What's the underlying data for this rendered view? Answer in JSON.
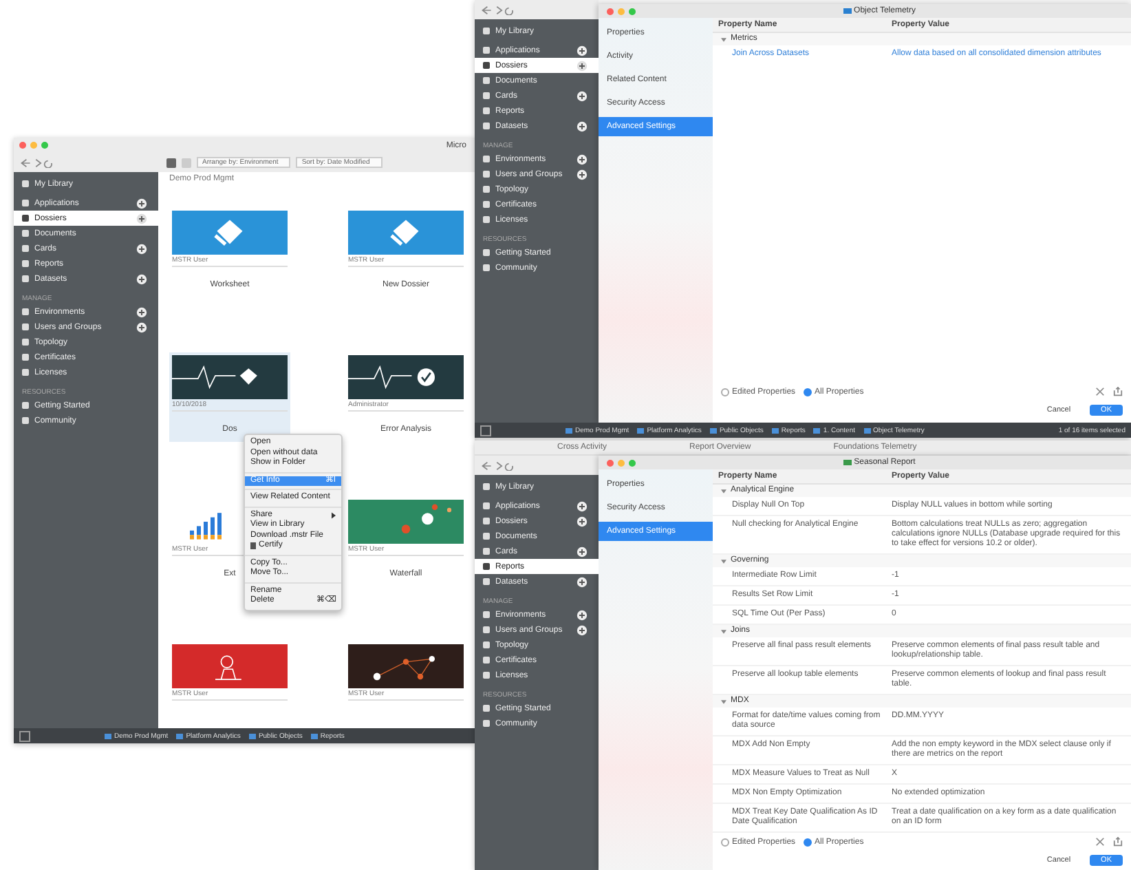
{
  "windows": [
    {
      "kind": "library",
      "title": "Micro",
      "toolbar": {
        "arrange": "Arrange by: Environment",
        "sort": "Sort by: Date Modified"
      },
      "sidebar": {
        "sections": [
          {
            "items": [
              {
                "label": "My Library",
                "selected": false,
                "add": false
              }
            ]
          },
          {
            "items": [
              {
                "label": "Applications",
                "selected": false,
                "add": true
              },
              {
                "label": "Dossiers",
                "selected": true,
                "add": true
              },
              {
                "label": "Documents",
                "selected": false,
                "add": false
              },
              {
                "label": "Cards",
                "selected": false,
                "add": true
              },
              {
                "label": "Reports",
                "selected": false,
                "add": false
              },
              {
                "label": "Datasets",
                "selected": false,
                "add": true
              }
            ]
          },
          {
            "header": "MANAGE",
            "items": [
              {
                "label": "Environments",
                "selected": false,
                "add": true
              },
              {
                "label": "Users and Groups",
                "selected": false,
                "add": true
              },
              {
                "label": "Topology",
                "selected": false,
                "add": false
              },
              {
                "label": "Certificates",
                "selected": false,
                "add": false
              },
              {
                "label": "Licenses",
                "selected": false,
                "add": false
              }
            ]
          },
          {
            "header": "RESOURCES",
            "items": [
              {
                "label": "Getting Started",
                "selected": false,
                "add": false
              },
              {
                "label": "Community",
                "selected": false,
                "add": false
              }
            ]
          }
        ]
      },
      "group": "Demo Prod Mgmt",
      "cards": [
        {
          "kind": "blue",
          "owner": "MSTR User",
          "title": "Worksheet",
          "selected": false
        },
        {
          "kind": "blue",
          "owner": "MSTR User",
          "title": "New Dossier",
          "selected": false
        },
        {
          "kind": "pulse",
          "owner": "10/10/2018",
          "title": "Dos",
          "selected": true
        },
        {
          "kind": "check",
          "owner": "Administrator",
          "title": "Error Analysis",
          "selected": false
        },
        {
          "kind": "bars",
          "owner": "MSTR User",
          "title": "Ext",
          "selected": false
        },
        {
          "kind": "bubbles",
          "owner": "MSTR User",
          "title": "Waterfall",
          "selected": false
        },
        {
          "kind": "red",
          "owner": "MSTR User",
          "selected": false
        },
        {
          "kind": "network",
          "owner": "MSTR User",
          "selected": false
        }
      ],
      "menu": [
        {
          "kind": "item",
          "label": "Open",
          "selected": false
        },
        {
          "kind": "item",
          "label": "Open without data",
          "selected": false
        },
        {
          "kind": "item",
          "label": "Show in Folder",
          "selected": false
        },
        {
          "kind": "separator"
        },
        {
          "kind": "item",
          "label": "Get Info",
          "shortcut": "⌘I",
          "selected": true
        },
        {
          "kind": "separator"
        },
        {
          "kind": "item",
          "label": "View Related Content",
          "selected": false
        },
        {
          "kind": "separator"
        },
        {
          "kind": "item",
          "label": "Share",
          "submenu": true,
          "selected": false
        },
        {
          "kind": "item",
          "label": "View in Library",
          "selected": false
        },
        {
          "kind": "item",
          "label": "Download .mstr File",
          "selected": false
        },
        {
          "kind": "item",
          "label": "Certify",
          "icon": true,
          "selected": false
        },
        {
          "kind": "separator"
        },
        {
          "kind": "item",
          "label": "Copy To...",
          "selected": false
        },
        {
          "kind": "item",
          "label": "Move To...",
          "selected": false
        },
        {
          "kind": "separator"
        },
        {
          "kind": "item",
          "label": "Rename",
          "selected": false
        },
        {
          "kind": "item",
          "label": "Delete",
          "shortcut": "⌘⌫",
          "selected": false
        }
      ],
      "breadcrumb": [
        "Demo Prod Mgmt",
        "Platform Analytics",
        "Public Objects",
        "Reports"
      ]
    },
    {
      "kind": "properties",
      "sidebar": {
        "sections": [
          {
            "items": [
              {
                "label": "My Library",
                "selected": false,
                "add": false
              }
            ]
          },
          {
            "items": [
              {
                "label": "Applications",
                "selected": false,
                "add": true
              },
              {
                "label": "Dossiers",
                "selected": true,
                "add": true
              },
              {
                "label": "Documents",
                "selected": false,
                "add": false
              },
              {
                "label": "Cards",
                "selected": false,
                "add": true
              },
              {
                "label": "Reports",
                "selected": false,
                "add": false
              },
              {
                "label": "Datasets",
                "selected": false,
                "add": true
              }
            ]
          },
          {
            "header": "MANAGE",
            "items": [
              {
                "label": "Environments",
                "selected": false,
                "add": true
              },
              {
                "label": "Users and Groups",
                "selected": false,
                "add": true
              },
              {
                "label": "Topology",
                "selected": false,
                "add": false
              },
              {
                "label": "Certificates",
                "selected": false,
                "add": false
              },
              {
                "label": "Licenses",
                "selected": false,
                "add": false
              }
            ]
          },
          {
            "header": "RESOURCES",
            "items": [
              {
                "label": "Getting Started",
                "selected": false,
                "add": false
              },
              {
                "label": "Community",
                "selected": false,
                "add": false
              }
            ]
          }
        ]
      },
      "dialog": {
        "title": "Object Telemetry",
        "nav": [
          {
            "label": "Properties",
            "selected": false
          },
          {
            "label": "Activity",
            "selected": false
          },
          {
            "label": "Related Content",
            "selected": false
          },
          {
            "label": "Security Access",
            "selected": false
          },
          {
            "label": "Advanced Settings",
            "selected": true
          }
        ],
        "columns": [
          "Property Name",
          "Property Value"
        ],
        "rows": [
          {
            "kind": "group",
            "label": "Metrics",
            "expanded": true
          },
          {
            "kind": "property",
            "name": "Join Across Datasets",
            "value": "Allow data based on all consolidated dimension attributes",
            "link": true
          }
        ],
        "filters": [
          {
            "label": "Edited Properties",
            "selected": false
          },
          {
            "label": "All Properties",
            "selected": true
          }
        ],
        "buttons": [
          "Cancel",
          "OK"
        ]
      },
      "breadcrumb": [
        "Demo Prod Mgmt",
        "Platform Analytics",
        "Public Objects",
        "Reports",
        "1. Content",
        "Object Telemetry"
      ],
      "status": "1 of 16 items selected"
    },
    {
      "kind": "properties",
      "tabs": [
        "Cross Activity",
        "Report Overview",
        "Foundations Telemetry"
      ],
      "sidebar": {
        "sections": [
          {
            "items": [
              {
                "label": "My Library",
                "selected": false,
                "add": false
              }
            ]
          },
          {
            "items": [
              {
                "label": "Applications",
                "selected": false,
                "add": true
              },
              {
                "label": "Dossiers",
                "selected": false,
                "add": true
              },
              {
                "label": "Documents",
                "selected": false,
                "add": false
              },
              {
                "label": "Cards",
                "selected": false,
                "add": true
              },
              {
                "label": "Reports",
                "selected": true,
                "add": false
              },
              {
                "label": "Datasets",
                "selected": false,
                "add": true
              }
            ]
          },
          {
            "header": "MANAGE",
            "items": [
              {
                "label": "Environments",
                "selected": false,
                "add": true
              },
              {
                "label": "Users and Groups",
                "selected": false,
                "add": true
              },
              {
                "label": "Topology",
                "selected": false,
                "add": false
              },
              {
                "label": "Certificates",
                "selected": false,
                "add": false
              },
              {
                "label": "Licenses",
                "selected": false,
                "add": false
              }
            ]
          },
          {
            "header": "RESOURCES",
            "items": [
              {
                "label": "Getting Started",
                "selected": false,
                "add": false
              },
              {
                "label": "Community",
                "selected": false,
                "add": false
              }
            ]
          }
        ]
      },
      "dialog": {
        "title": "Seasonal Report",
        "nav": [
          {
            "label": "Properties",
            "selected": false
          },
          {
            "label": "Security Access",
            "selected": false
          },
          {
            "label": "Advanced Settings",
            "selected": true
          }
        ],
        "columns": [
          "Property Name",
          "Property Value"
        ],
        "rows": [
          {
            "kind": "group",
            "label": "Analytical Engine",
            "expanded": true
          },
          {
            "kind": "property",
            "name": "Display Null On Top",
            "value": "Display NULL values in bottom while sorting",
            "link": false
          },
          {
            "kind": "property",
            "name": "Null checking for Analytical Engine",
            "value": "Bottom calculations treat NULLs as zero; aggregation calculations ignore NULLs (Database upgrade required for this to take effect for versions 10.2 or older).",
            "link": false
          },
          {
            "kind": "group",
            "label": "Governing",
            "expanded": true
          },
          {
            "kind": "property",
            "name": "Intermediate Row Limit",
            "value": "-1",
            "link": false
          },
          {
            "kind": "property",
            "name": "Results Set Row Limit",
            "value": "-1",
            "link": false
          },
          {
            "kind": "property",
            "name": "SQL Time Out (Per Pass)",
            "value": "0",
            "link": false
          },
          {
            "kind": "group",
            "label": "Joins",
            "expanded": true
          },
          {
            "kind": "property",
            "name": "Preserve all final pass result elements",
            "value": "Preserve common elements of final pass result table and lookup/relationship table.",
            "link": false
          },
          {
            "kind": "property",
            "name": "Preserve all lookup table elements",
            "value": "Preserve common elements of lookup and final pass result table.",
            "link": false
          },
          {
            "kind": "group",
            "label": "MDX",
            "expanded": true
          },
          {
            "kind": "property",
            "name": "Format for date/time values coming from data source",
            "value": "DD.MM.YYYY",
            "link": false
          },
          {
            "kind": "property",
            "name": "MDX Add Non Empty",
            "value": "Add the non empty keyword in the MDX select clause only if there are metrics on the report",
            "link": false
          },
          {
            "kind": "property",
            "name": "MDX Measure Values to Treat as Null",
            "value": "X",
            "link": false
          },
          {
            "kind": "property",
            "name": "MDX Non Empty Optimization",
            "value": "No extended optimization",
            "link": false
          },
          {
            "kind": "property",
            "name": "MDX Treat Key Date Qualification As ID Date Qualification",
            "value": "Treat a date qualification on a key form as a date qualification on an ID form",
            "link": false
          }
        ],
        "filters": [
          {
            "label": "Edited Properties",
            "selected": false
          },
          {
            "label": "All Properties",
            "selected": true
          }
        ],
        "buttons": [
          "Cancel",
          "OK"
        ]
      }
    }
  ]
}
